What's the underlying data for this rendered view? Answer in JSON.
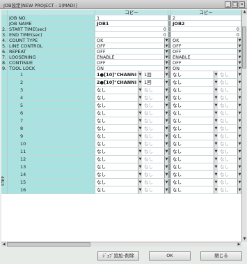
{
  "window": {
    "title": "JOB設定[NEW PROJECT - 1(MAD)]",
    "controls": [
      "_",
      "□",
      "×"
    ]
  },
  "columns": {
    "job_a_header": "コピー",
    "job_b_header": "コピー"
  },
  "rows": [
    {
      "num": "",
      "label": "JOB NO.",
      "a": "1",
      "b": "2"
    },
    {
      "num": "",
      "label": "JOB NAME",
      "a": "JOB1",
      "b": "JOB2"
    },
    {
      "num": "2.",
      "label": "START TIME(sec)",
      "a": "0",
      "b": "0"
    },
    {
      "num": "3.",
      "label": "END TIME(sec)",
      "a": "0",
      "b": "0"
    },
    {
      "num": "4.",
      "label": "COUNT TYPE",
      "a": "OK",
      "b": "OK"
    },
    {
      "num": "5.",
      "label": "LINE CONTROL",
      "a": "OFF",
      "b": "OFF"
    },
    {
      "num": "6.",
      "label": "REPEAT",
      "a": "OFF",
      "b": "OFF"
    },
    {
      "num": "7.",
      "label": "LOOSENING",
      "a": "ENABLE",
      "b": "ENABLE"
    },
    {
      "num": "8.",
      "label": "CONTINUE",
      "a": "OFF",
      "b": "OFF"
    },
    {
      "num": "9.",
      "label": "TOOL LOCK",
      "a": "ON",
      "b": "ON"
    }
  ],
  "steps": {
    "section_label": "STEP",
    "items": [
      {
        "n": "1",
        "a": "1●[10]\"CHANNI",
        "a_extra": "1回",
        "b": "なし"
      },
      {
        "n": "2",
        "a": "2●[10]\"CHANNI",
        "a_extra": "1回",
        "b": "なし"
      },
      {
        "n": "3",
        "a": "なし",
        "a_extra": "なし",
        "b": "なし"
      },
      {
        "n": "4",
        "a": "なし",
        "a_extra": "なし",
        "b": "なし"
      },
      {
        "n": "5",
        "a": "なし",
        "a_extra": "なし",
        "b": "なし"
      },
      {
        "n": "6",
        "a": "なし",
        "a_extra": "なし",
        "b": "なし"
      },
      {
        "n": "7",
        "a": "なし",
        "a_extra": "なし",
        "b": "なし"
      },
      {
        "n": "8",
        "a": "なし",
        "a_extra": "なし",
        "b": "なし"
      },
      {
        "n": "9",
        "a": "なし",
        "a_extra": "なし",
        "b": "なし"
      },
      {
        "n": "10",
        "a": "なし",
        "a_extra": "なし",
        "b": "なし"
      },
      {
        "n": "11",
        "a": "なし",
        "a_extra": "なし",
        "b": "なし"
      },
      {
        "n": "12",
        "a": "なし",
        "a_extra": "なし",
        "b": "なし"
      },
      {
        "n": "13",
        "a": "なし",
        "a_extra": "なし",
        "b": "なし"
      },
      {
        "n": "14",
        "a": "なし",
        "a_extra": "なし",
        "b": "なし"
      },
      {
        "n": "15",
        "a": "なし",
        "a_extra": "なし",
        "b": "なし"
      },
      {
        "n": "16",
        "a": "なし",
        "a_extra": "なし",
        "b": "なし"
      }
    ]
  },
  "footer": {
    "add_delete_label": "ｼﾞｮﾌﾞ追加･削除",
    "ok_label": "OK",
    "close_label": "閉じる"
  },
  "colors": {
    "label_bg": "#a9e3e1",
    "title_bg": "#c9c9c9"
  }
}
